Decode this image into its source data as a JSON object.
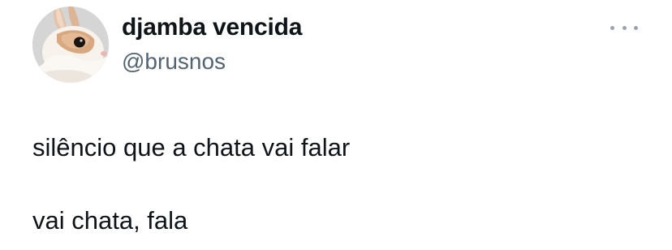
{
  "author": {
    "display_name": "djamba vencida",
    "handle": "@brusnos",
    "avatar_icon": "bunny-avatar-icon"
  },
  "menu": {
    "icon": "more-options-icon"
  },
  "tweet": {
    "lines": [
      "silêncio que a chata vai falar",
      "vai chata, fala"
    ]
  },
  "colors": {
    "text": "#0f1419",
    "secondary_text": "#536471",
    "more_dots": "#9aa4ad",
    "background": "#ffffff"
  }
}
